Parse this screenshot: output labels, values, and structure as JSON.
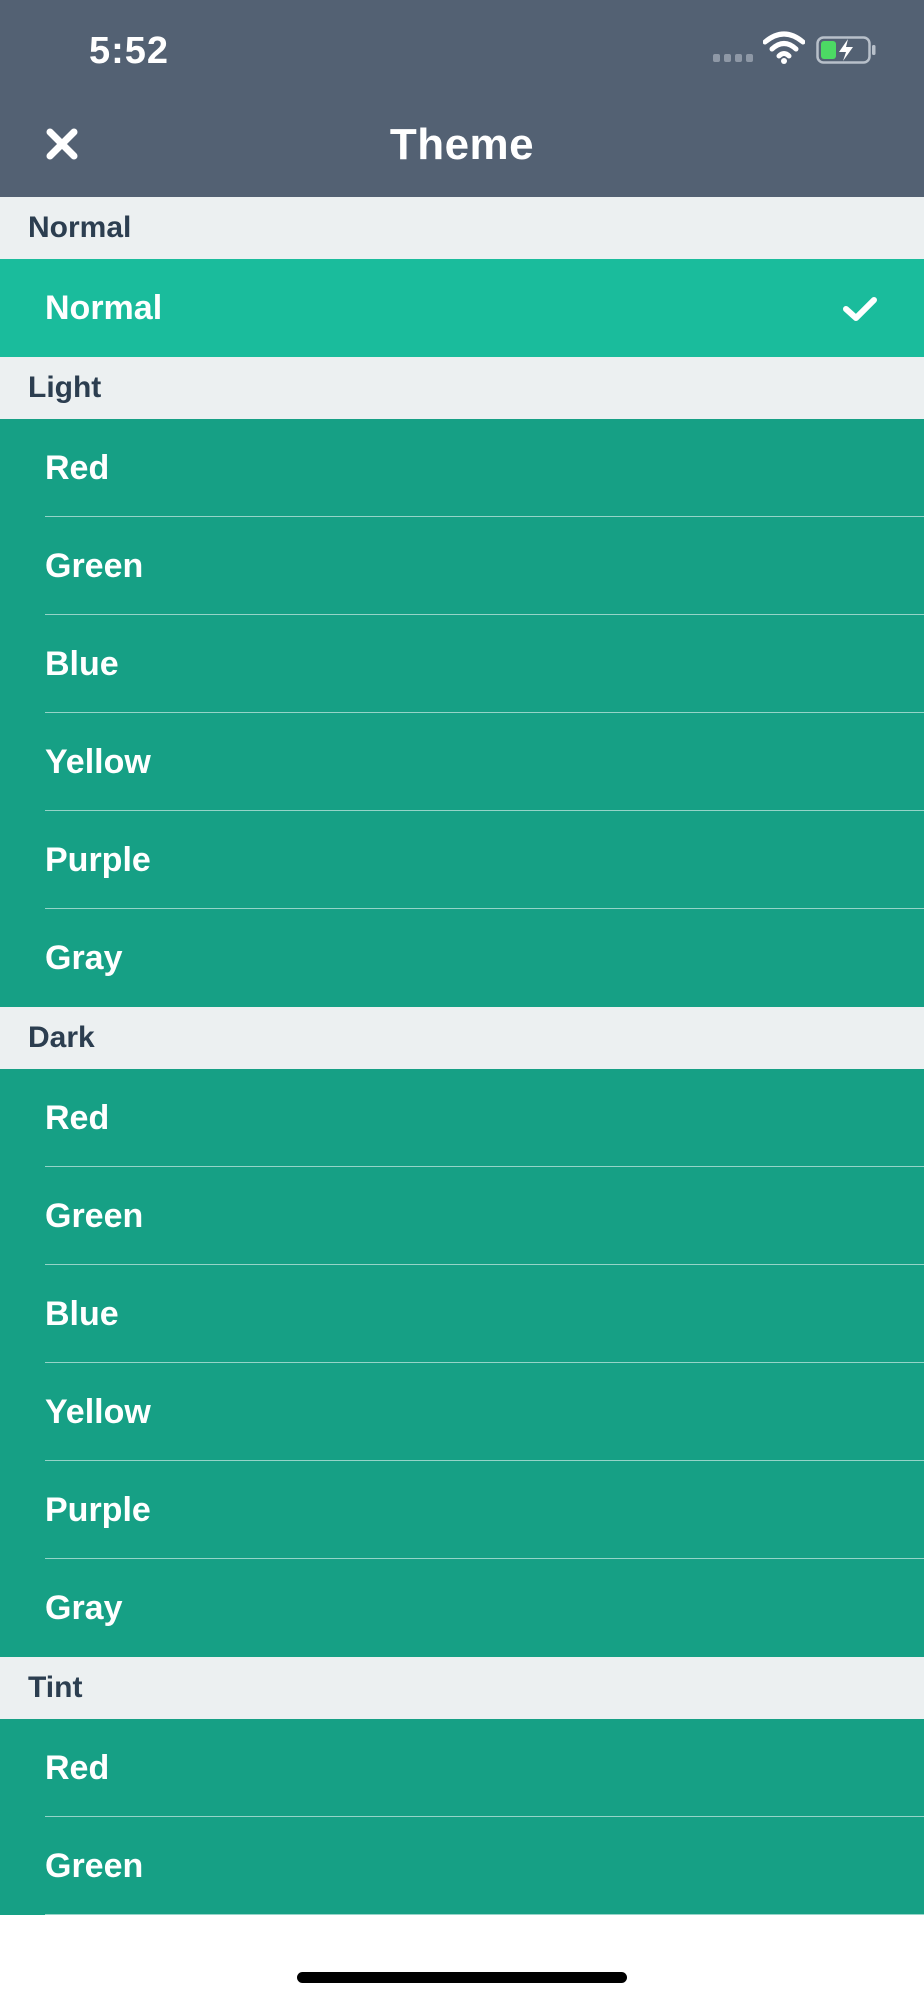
{
  "status_bar": {
    "time": "5:52"
  },
  "header": {
    "title": "Theme",
    "close_icon": "close-icon"
  },
  "colors": {
    "header_bg": "#536173",
    "section_bg": "#ecf0f1",
    "row_bg": "#16a085",
    "selected_row_bg": "#1abc9c",
    "text": "#ffffff"
  },
  "sections": [
    {
      "title": "Normal",
      "items": [
        {
          "label": "Normal",
          "selected": true
        }
      ]
    },
    {
      "title": "Light",
      "items": [
        {
          "label": "Red"
        },
        {
          "label": "Green"
        },
        {
          "label": "Blue"
        },
        {
          "label": "Yellow"
        },
        {
          "label": "Purple"
        },
        {
          "label": "Gray"
        }
      ]
    },
    {
      "title": "Dark",
      "items": [
        {
          "label": "Red"
        },
        {
          "label": "Green"
        },
        {
          "label": "Blue"
        },
        {
          "label": "Yellow"
        },
        {
          "label": "Purple"
        },
        {
          "label": "Gray"
        }
      ]
    },
    {
      "title": "Tint",
      "items": [
        {
          "label": "Red"
        },
        {
          "label": "Green"
        }
      ]
    }
  ]
}
